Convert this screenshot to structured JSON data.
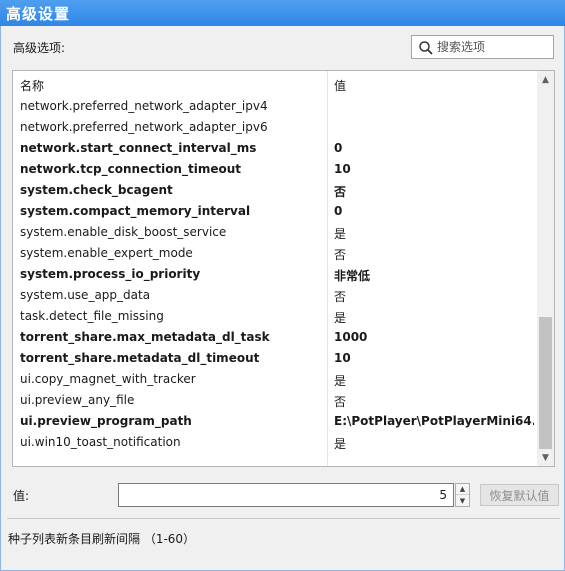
{
  "window": {
    "title": "高级设置"
  },
  "section_label": "高级选项:",
  "search": {
    "placeholder": "搜索选项"
  },
  "list": {
    "columns": {
      "name": "名称",
      "value": "值"
    },
    "rows": [
      {
        "key": "network.preferred_network_adapter_ipv4",
        "value": "",
        "modified": false
      },
      {
        "key": "network.preferred_network_adapter_ipv6",
        "value": "",
        "modified": false
      },
      {
        "key": "network.start_connect_interval_ms",
        "value": "0",
        "modified": true
      },
      {
        "key": "network.tcp_connection_timeout",
        "value": "10",
        "modified": true
      },
      {
        "key": "system.check_bcagent",
        "value": "否",
        "modified": true
      },
      {
        "key": "system.compact_memory_interval",
        "value": "0",
        "modified": true
      },
      {
        "key": "system.enable_disk_boost_service",
        "value": "是",
        "modified": false
      },
      {
        "key": "system.enable_expert_mode",
        "value": "否",
        "modified": false
      },
      {
        "key": "system.process_io_priority",
        "value": "非常低",
        "modified": true
      },
      {
        "key": "system.use_app_data",
        "value": "否",
        "modified": false
      },
      {
        "key": "task.detect_file_missing",
        "value": "是",
        "modified": false
      },
      {
        "key": "torrent_share.max_metadata_dl_task",
        "value": "1000",
        "modified": true
      },
      {
        "key": "torrent_share.metadata_dl_timeout",
        "value": "10",
        "modified": true
      },
      {
        "key": "ui.copy_magnet_with_tracker",
        "value": "是",
        "modified": false
      },
      {
        "key": "ui.preview_any_file",
        "value": "否",
        "modified": false
      },
      {
        "key": "ui.preview_program_path",
        "value": "E:\\PotPlayer\\PotPlayerMini64....",
        "modified": true
      },
      {
        "key": "ui.win10_toast_notification",
        "value": "是",
        "modified": false
      }
    ]
  },
  "value_field": {
    "label": "值:",
    "value": "5"
  },
  "reset_button": {
    "label": "恢复默认值"
  },
  "description": "种子列表新条目刷新间隔 （1-60）",
  "colors": {
    "titlebar": "#2f86e6",
    "disabled_text": "#8d8d8d"
  }
}
